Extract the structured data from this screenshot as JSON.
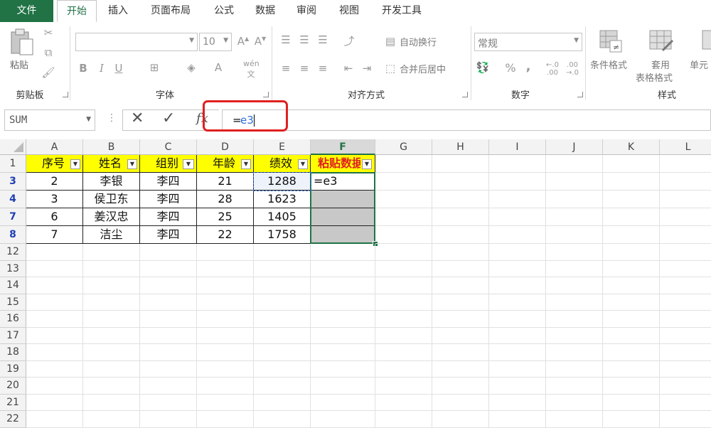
{
  "tabs": [
    "文件",
    "开始",
    "插入",
    "页面布局",
    "公式",
    "数据",
    "审阅",
    "视图",
    "开发工具"
  ],
  "ribbon": {
    "clipboard": {
      "paste": "粘贴",
      "label": "剪贴板"
    },
    "font": {
      "size": "10",
      "bold": "B",
      "italic": "I",
      "underline": "U",
      "label": "字体"
    },
    "alignment": {
      "wrap": "自动换行",
      "merge": "合并后居中",
      "label": "对齐方式"
    },
    "number": {
      "format": "常规",
      "percent": "%",
      "comma": ",",
      "label": "数字"
    },
    "styles": {
      "conditional": "条件格式",
      "table_line1": "套用",
      "table_line2": "表格格式",
      "cell": "单元",
      "label": "样式"
    }
  },
  "formula_bar": {
    "name_box": "SUM",
    "fx": "fx",
    "content_eq": "=",
    "content_ref": "e3"
  },
  "columns": [
    "A",
    "B",
    "C",
    "D",
    "E",
    "F",
    "G",
    "H",
    "I",
    "J",
    "K",
    "L"
  ],
  "header_row": {
    "num": "1",
    "cells": [
      "序号",
      "姓名",
      "组别",
      "年龄",
      "绩效",
      "粘贴数据"
    ]
  },
  "data_rows": [
    {
      "num": "3",
      "cells": [
        "2",
        "李银",
        "李四",
        "21",
        "1288",
        "=e3"
      ]
    },
    {
      "num": "4",
      "cells": [
        "3",
        "侯卫东",
        "李四",
        "28",
        "1623",
        ""
      ]
    },
    {
      "num": "7",
      "cells": [
        "6",
        "姜汉忠",
        "李四",
        "25",
        "1405",
        ""
      ]
    },
    {
      "num": "8",
      "cells": [
        "7",
        "洁尘",
        "李四",
        "22",
        "1758",
        ""
      ]
    }
  ],
  "empty_rows": [
    "12",
    "13",
    "14",
    "15",
    "16",
    "17",
    "18",
    "19",
    "20",
    "21",
    "22"
  ],
  "colors": {
    "accent": "#217346",
    "highlight_red": "#e02020",
    "header_fill": "#ffff00",
    "ref_blue": "#2f6fd6"
  }
}
